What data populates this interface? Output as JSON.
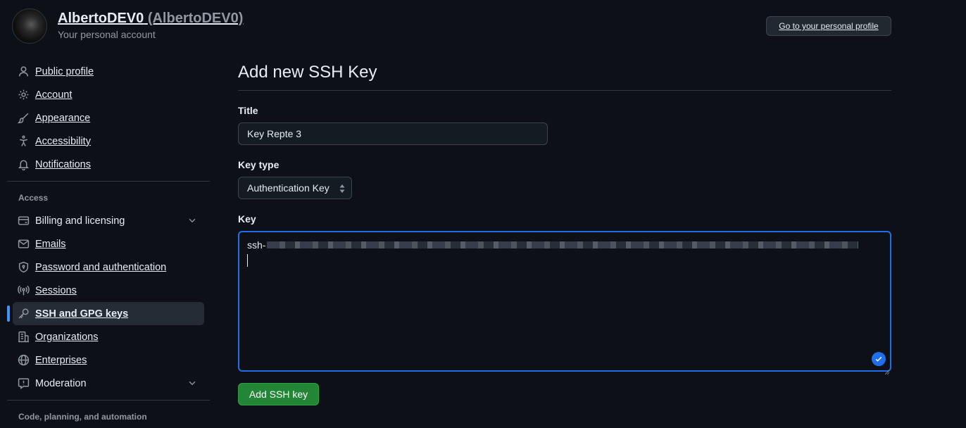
{
  "header": {
    "display_name": "AlbertoDEV0",
    "handle": "(AlbertoDEV0)",
    "subtitle": "Your personal account",
    "profile_button": "Go to your personal profile"
  },
  "sidebar": {
    "items_top": [
      {
        "label": "Public profile",
        "icon": "person-icon"
      },
      {
        "label": "Account",
        "icon": "gear-icon"
      },
      {
        "label": "Appearance",
        "icon": "paintbrush-icon"
      },
      {
        "label": "Accessibility",
        "icon": "accessibility-icon"
      },
      {
        "label": "Notifications",
        "icon": "bell-icon"
      }
    ],
    "access_heading": "Access",
    "items_access": [
      {
        "label": "Billing and licensing",
        "icon": "credit-card-icon"
      },
      {
        "label": "Emails",
        "icon": "mail-icon"
      },
      {
        "label": "Password and authentication",
        "icon": "shield-lock-icon"
      },
      {
        "label": "Sessions",
        "icon": "broadcast-icon"
      },
      {
        "label": "SSH and GPG keys",
        "icon": "key-icon"
      },
      {
        "label": "Organizations",
        "icon": "organization-icon"
      },
      {
        "label": "Enterprises",
        "icon": "globe-icon"
      },
      {
        "label": "Moderation",
        "icon": "report-icon"
      }
    ],
    "next_heading": "Code, planning, and automation"
  },
  "main": {
    "title": "Add new SSH Key",
    "title_field": {
      "label": "Title",
      "value": "Key Repte 3"
    },
    "key_type": {
      "label": "Key type",
      "selected": "Authentication Key"
    },
    "key": {
      "label": "Key",
      "value_prefix": "ssh-"
    },
    "submit_label": "Add SSH key"
  },
  "colors": {
    "background": "#0d1117",
    "accent": "#4493f8",
    "focus_border": "#1f6feb",
    "primary_button": "#238636"
  }
}
